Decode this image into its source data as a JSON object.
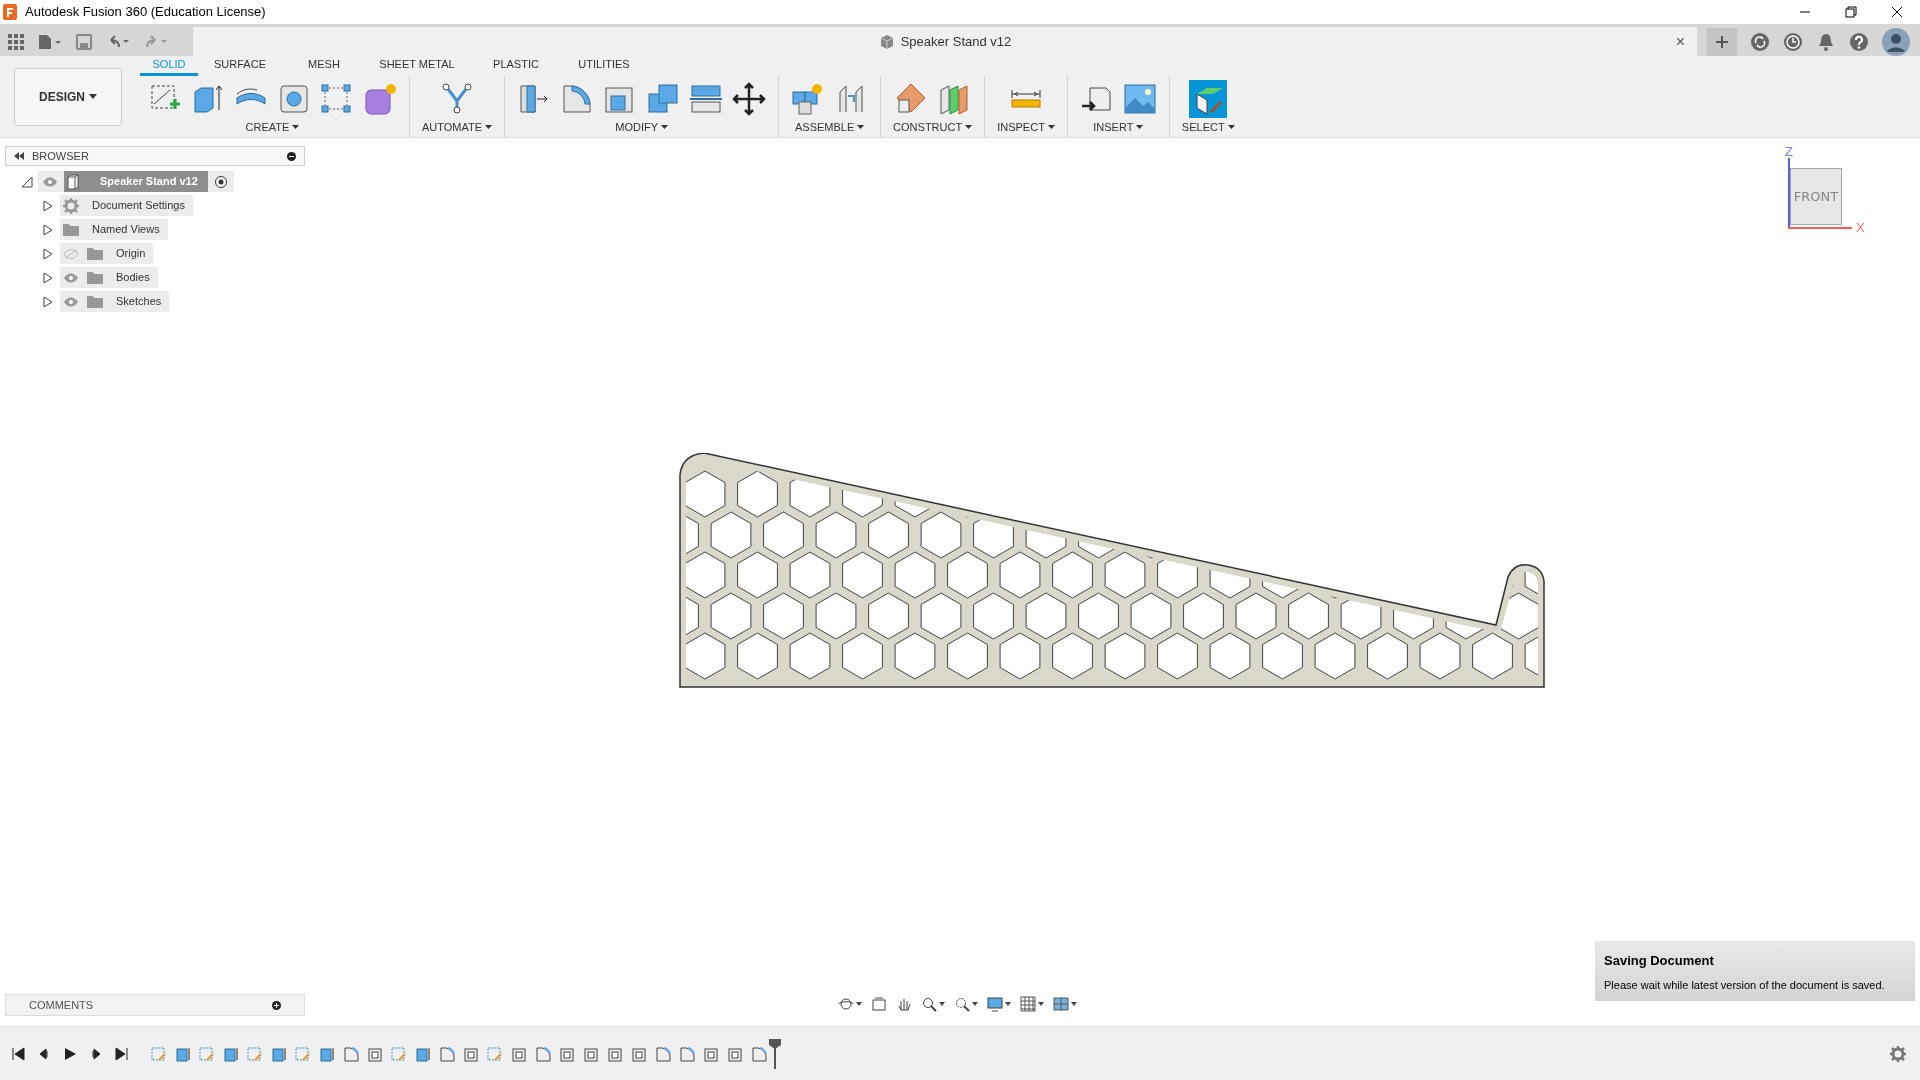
{
  "window": {
    "title": "Autodesk Fusion 360 (Education License)"
  },
  "document_tab": {
    "title": "Speaker Stand v12",
    "close": "×"
  },
  "workspace": {
    "label": "DESIGN"
  },
  "tabs": [
    {
      "label": "SOLID",
      "selected": true
    },
    {
      "label": "SURFACE",
      "selected": false
    },
    {
      "label": "MESH",
      "selected": false
    },
    {
      "label": "SHEET METAL",
      "selected": false
    },
    {
      "label": "PLASTIC",
      "selected": false
    },
    {
      "label": "UTILITIES",
      "selected": false
    }
  ],
  "toolbar_groups": [
    {
      "label": "CREATE"
    },
    {
      "label": "AUTOMATE"
    },
    {
      "label": "MODIFY"
    },
    {
      "label": "ASSEMBLE"
    },
    {
      "label": "CONSTRUCT"
    },
    {
      "label": "INSPECT"
    },
    {
      "label": "INSERT"
    },
    {
      "label": "SELECT"
    }
  ],
  "browser": {
    "title": "BROWSER",
    "root": {
      "label": "Speaker Stand v12",
      "expanded": true,
      "visible": true,
      "children": [
        {
          "label": "Document Settings",
          "kind": "settings",
          "expanded": false
        },
        {
          "label": "Named Views",
          "kind": "folder",
          "expanded": false
        },
        {
          "label": "Origin",
          "kind": "folder",
          "expanded": false,
          "visible": false
        },
        {
          "label": "Bodies",
          "kind": "folder",
          "expanded": false,
          "visible": true
        },
        {
          "label": "Sketches",
          "kind": "folder",
          "expanded": false,
          "visible": true
        }
      ]
    }
  },
  "view_cube": {
    "face": "FRONT",
    "z_axis": "Z",
    "x_axis": "X"
  },
  "comments": {
    "title": "COMMENTS"
  },
  "notification": {
    "title": "Saving Document",
    "message": "Please wait while latest version of the document is saved."
  }
}
